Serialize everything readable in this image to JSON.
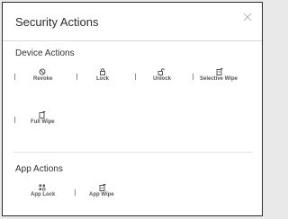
{
  "dialog": {
    "title": "Security Actions",
    "close_icon": "close-icon"
  },
  "device_actions": {
    "title": "Device Actions",
    "items": [
      {
        "label": "Revoke",
        "icon": "revoke-icon"
      },
      {
        "label": "Lock",
        "icon": "lock-icon"
      },
      {
        "label": "Unlock",
        "icon": "unlock-icon"
      },
      {
        "label": "Selective Wipe",
        "icon": "selective-wipe-icon"
      },
      {
        "label": "Full Wipe",
        "icon": "full-wipe-icon"
      }
    ]
  },
  "app_actions": {
    "title": "App Actions",
    "items": [
      {
        "label": "App Lock",
        "icon": "app-lock-icon"
      },
      {
        "label": "App Wipe",
        "icon": "app-wipe-icon"
      }
    ]
  },
  "colors": {
    "text": "#333333",
    "label": "#555555",
    "divider": "#dcdcdc",
    "border": "#2b2b2b"
  }
}
